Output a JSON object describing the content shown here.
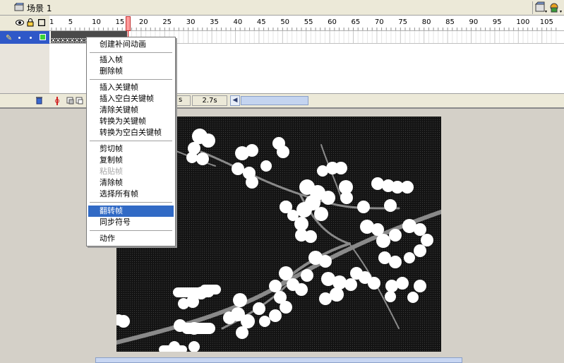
{
  "scene": {
    "label": "场景 1"
  },
  "timeline": {
    "ruler_ticks": [
      "1",
      "5",
      "10",
      "15",
      "20",
      "25",
      "30",
      "35",
      "40",
      "45",
      "50",
      "55",
      "60",
      "65",
      "70",
      "75",
      "80",
      "85",
      "90",
      "95",
      "100",
      "105"
    ],
    "time_readout": "2.7s",
    "fps_fragment": "s"
  },
  "context_menu": {
    "items": [
      {
        "label": "创建补间动画",
        "state": "normal"
      },
      {
        "label": "插入帧",
        "state": "normal"
      },
      {
        "label": "删除帧",
        "state": "normal"
      },
      {
        "label": "插入关键帧",
        "state": "normal"
      },
      {
        "label": "插入空白关键帧",
        "state": "normal"
      },
      {
        "label": "清除关键帧",
        "state": "normal"
      },
      {
        "label": "转换为关键帧",
        "state": "normal"
      },
      {
        "label": "转换为空白关键帧",
        "state": "normal"
      },
      {
        "label": "剪切帧",
        "state": "normal"
      },
      {
        "label": "复制帧",
        "state": "normal"
      },
      {
        "label": "粘贴帧",
        "state": "disabled"
      },
      {
        "label": "清除帧",
        "state": "normal"
      },
      {
        "label": "选择所有帧",
        "state": "normal"
      },
      {
        "label": "翻转帧",
        "state": "highlighted"
      },
      {
        "label": "同步符号",
        "state": "normal"
      },
      {
        "label": "动作",
        "state": "normal"
      }
    ]
  },
  "colors": {
    "menu_highlight": "#316ac5",
    "layer_selected": "#2f58c8",
    "playhead": "#ff9a9a",
    "layer_color": "#3ad23a"
  },
  "icons": [
    "scene-icon",
    "eye-icon",
    "lock-icon",
    "outline-icon",
    "pencil-icon",
    "trash-icon",
    "onion-skin-icon",
    "edit-scene-icon",
    "edit-symbol-icon"
  ]
}
